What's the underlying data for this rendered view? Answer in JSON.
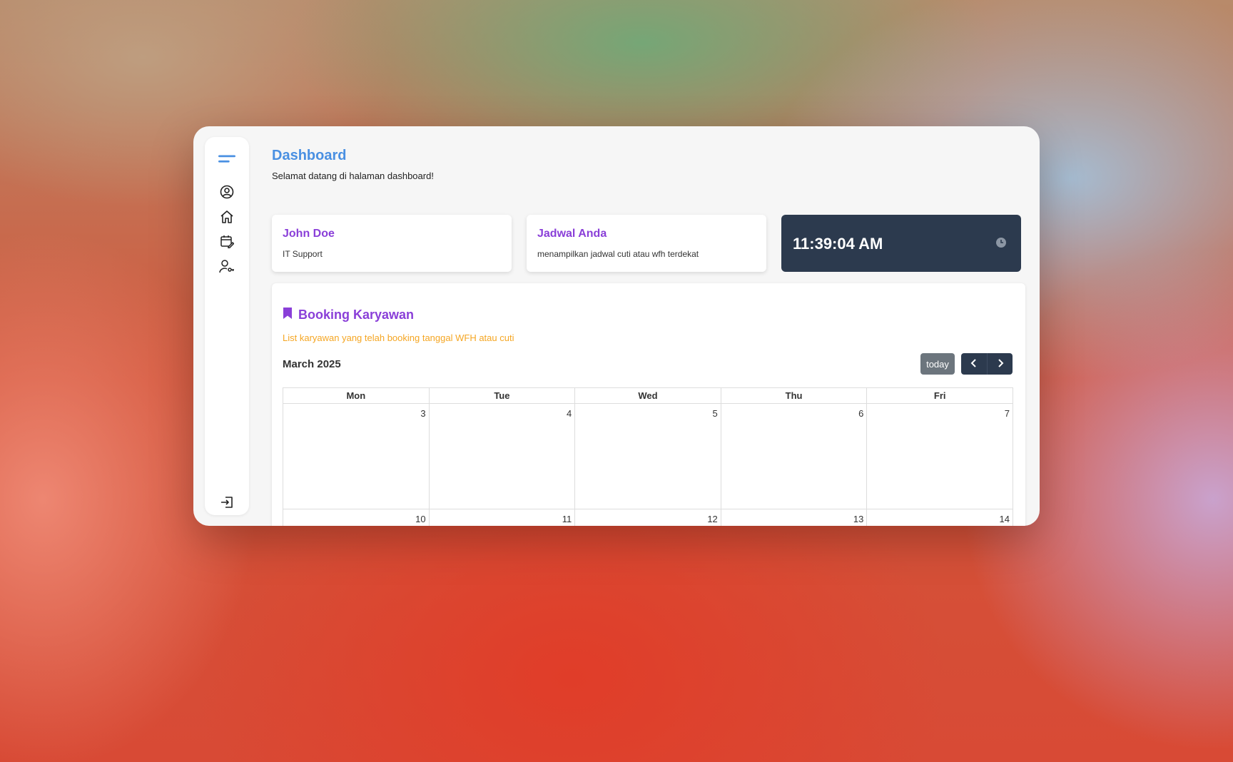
{
  "sidebar": {
    "icons": [
      "menu-icon",
      "user-circle-icon",
      "home-icon",
      "calendar-edit-icon",
      "user-key-icon",
      "logout-icon"
    ]
  },
  "header": {
    "title": "Dashboard",
    "subtitle": "Selamat datang di halaman dashboard!"
  },
  "cards": {
    "user": {
      "name": "John Doe",
      "role": "IT Support"
    },
    "schedule": {
      "title": "Jadwal Anda",
      "description": "menampilkan jadwal cuti atau wfh terdekat"
    },
    "clock": {
      "time": "11:39:04 AM",
      "icon": "clock-icon"
    }
  },
  "booking": {
    "title": "Booking Karyawan",
    "icon": "bookmark-icon",
    "subtitle": "List karyawan yang telah booking tanggal WFH atau cuti"
  },
  "calendar": {
    "month_label": "March 2025",
    "today_label": "today",
    "days": [
      "Mon",
      "Tue",
      "Wed",
      "Thu",
      "Fri"
    ],
    "weeks": [
      [
        "3",
        "4",
        "5",
        "6",
        "7"
      ],
      [
        "10",
        "11",
        "12",
        "13",
        "14"
      ]
    ]
  },
  "colors": {
    "accent_blue": "#4a90e2",
    "accent_purple": "#8a3fd8",
    "accent_orange": "#f5a623",
    "dark_navy": "#2c3a4e"
  }
}
